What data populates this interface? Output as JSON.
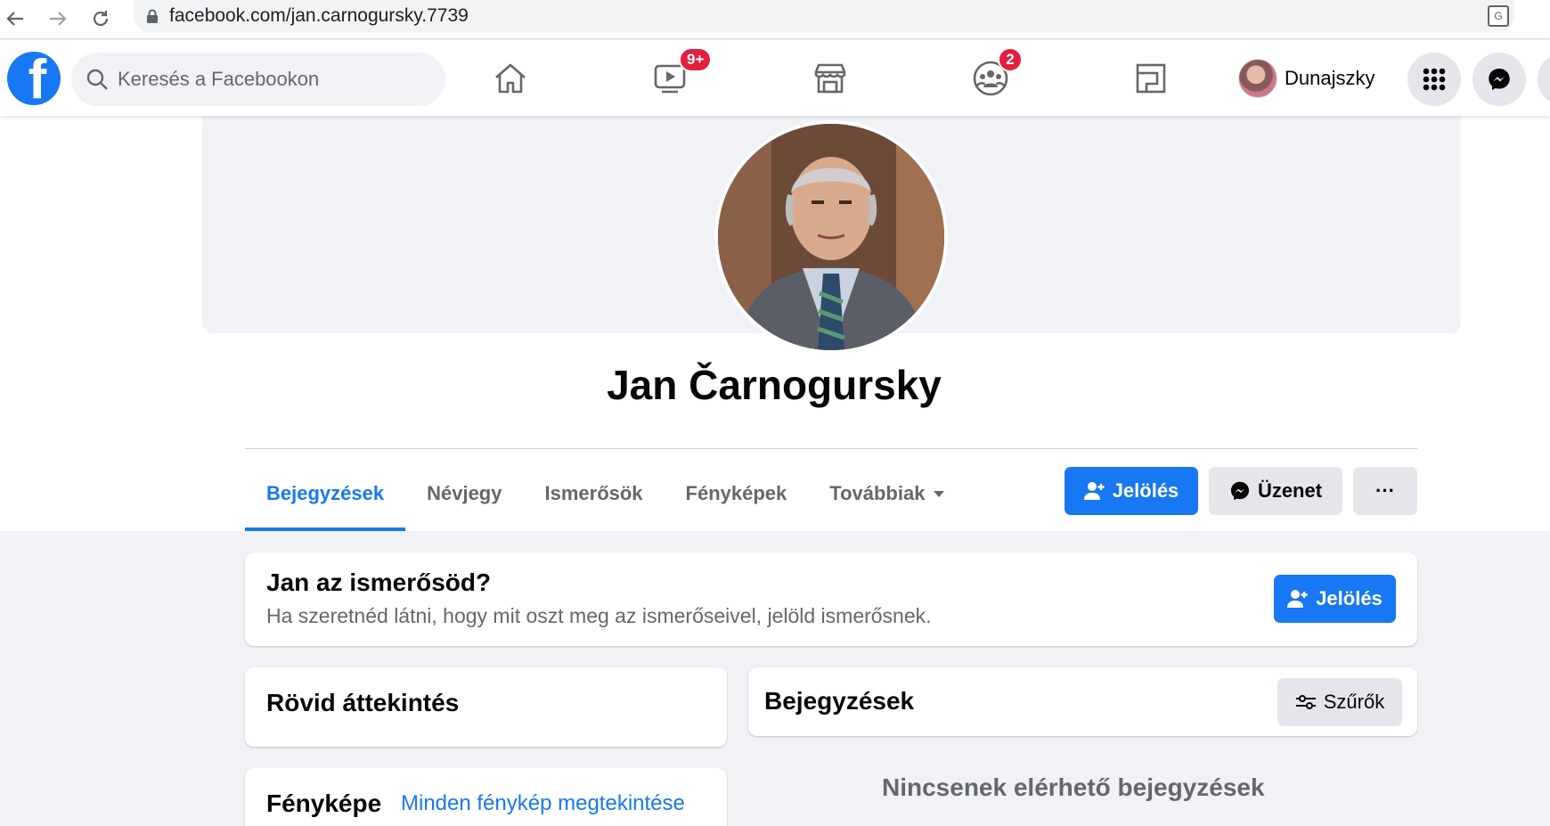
{
  "browser": {
    "url": "facebook.com/jan.carnogursky.7739"
  },
  "header": {
    "search_placeholder": "Keresés a Facebookon",
    "video_badge": "9+",
    "groups_badge": "2",
    "user_name": "Dunajszky"
  },
  "profile": {
    "name": "Jan Čarnogursky"
  },
  "tabs": [
    {
      "label": "Bejegyzések",
      "active": true
    },
    {
      "label": "Névjegy"
    },
    {
      "label": "Ismerősök"
    },
    {
      "label": "Fényképek"
    },
    {
      "label": "Továbbiak"
    }
  ],
  "actions": {
    "add_friend": "Jelölés",
    "message": "Üzenet",
    "more": "···"
  },
  "friend_prompt": {
    "title": "Jan az ismerősöd?",
    "subtitle": "Ha szeretnéd látni, hogy mit oszt meg az ismerőseivel, jelöld ismerősnek.",
    "button": "Jelölés"
  },
  "intro": {
    "title": "Rövid áttekintés"
  },
  "photos": {
    "title": "Fényképe",
    "link": "Minden fénykép megtekintése"
  },
  "posts": {
    "title": "Bejegyzések",
    "filters": "Szűrők",
    "empty": "Nincsenek elérhető bejegyzések"
  },
  "colors": {
    "brand": "#1877f2",
    "badge": "#e41e3f"
  }
}
